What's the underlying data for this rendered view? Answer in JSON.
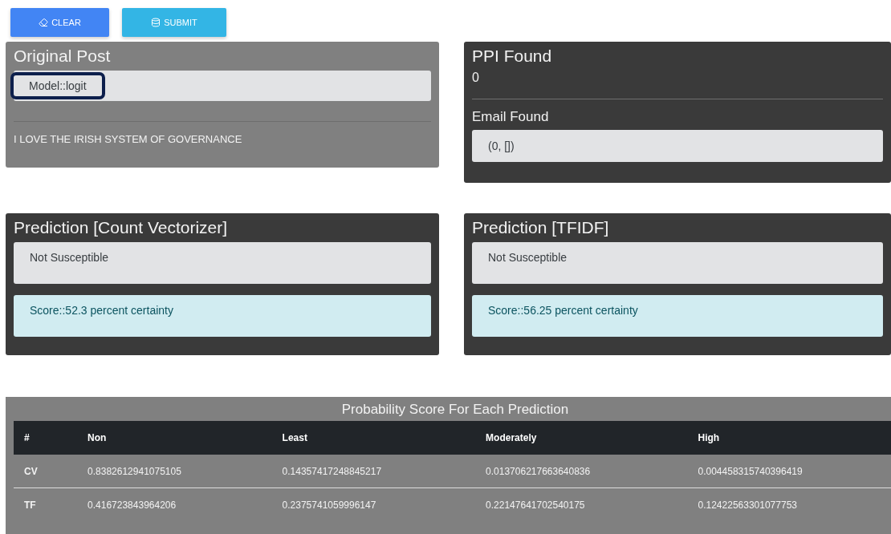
{
  "buttons": [
    {
      "label": "CLEAR",
      "kind": "clear"
    },
    {
      "label": "SUBMIT",
      "kind": "submit"
    }
  ],
  "original_post": {
    "title": "Original Post",
    "model": "Model::logit",
    "text": "I LOVE THE IRISH SYSTEM OF GOVERNANCE"
  },
  "ppi": {
    "title": "PPI Found",
    "value": "0",
    "email_title": "Email Found",
    "email_value": "(0, [])"
  },
  "predictions": [
    {
      "title": "Prediction [Count Vectorizer]",
      "label": "Not Susceptible",
      "score": "Score::52.3 percent certainty"
    },
    {
      "title": "Prediction [TFIDF]",
      "label": "Not Susceptible",
      "score": "Score::56.25 percent certainty"
    }
  ],
  "table": {
    "title": "Probability Score For Each Prediction",
    "columns": [
      "#",
      "Non",
      "Least",
      "Moderately",
      "High"
    ],
    "rows": [
      [
        "CV",
        "0.8382612941075105",
        "0.14357417248845217",
        "0.013706217663640836",
        "0.004458315740396419"
      ],
      [
        "TF",
        "0.416723843964206",
        "0.2375741059996147",
        "0.22147641702540175",
        "0.12422563301077753"
      ]
    ]
  }
}
